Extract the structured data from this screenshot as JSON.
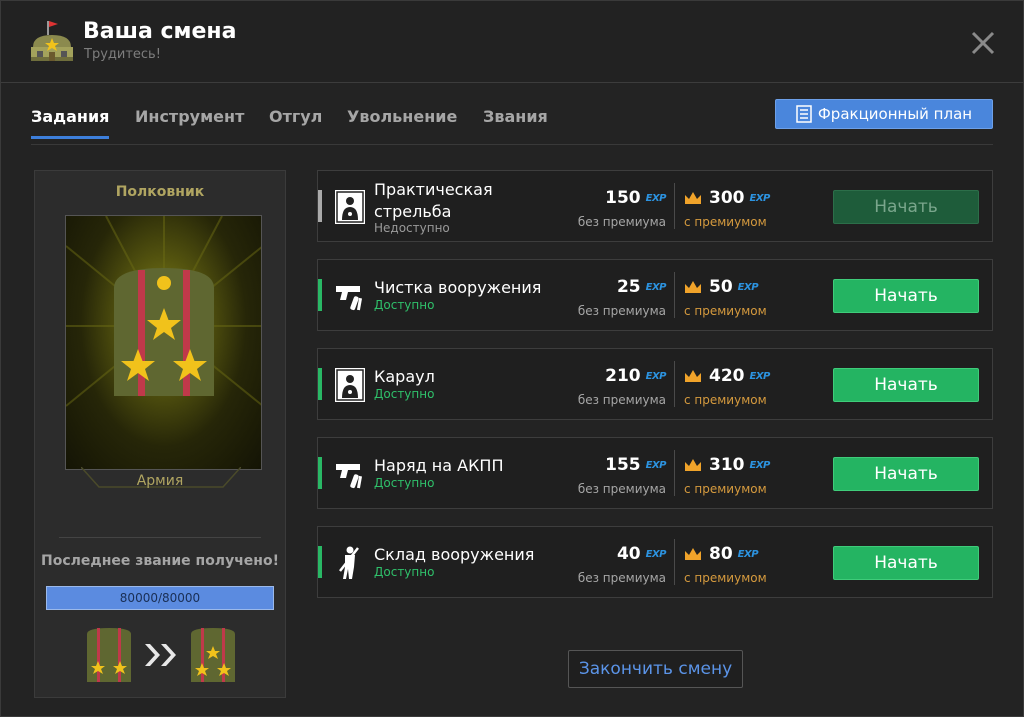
{
  "header": {
    "title": "Ваша смена",
    "subtitle": "Трудитесь!",
    "icon": "barracks-icon"
  },
  "tabs": [
    {
      "label": "Задания",
      "active": true
    },
    {
      "label": "Инструмент",
      "active": false
    },
    {
      "label": "Отгул",
      "active": false
    },
    {
      "label": "Увольнение",
      "active": false
    },
    {
      "label": "Звания",
      "active": false
    }
  ],
  "plan_button": {
    "label": "Фракционный план",
    "icon": "checklist-icon"
  },
  "rank_panel": {
    "rank_name": "Полковник",
    "branch": "Армия",
    "last_rank_message": "Последнее звание получено!",
    "progress": {
      "current": 80000,
      "max": 80000,
      "text": "80000/80000"
    },
    "transition_icon": "double-chevron-right-icon"
  },
  "exp_tag": "EXP",
  "tasks": [
    {
      "name": "Практическая стрельба",
      "name_lines": [
        "Практическая",
        "стрельба"
      ],
      "status": "Недоступно",
      "available": false,
      "icon": "shooting-target-icon",
      "exp_base": "150",
      "exp_premium": "300",
      "base_label": "без премиума",
      "premium_label": "с премиумом",
      "button": "Начать"
    },
    {
      "name": "Чистка вооружения",
      "name_lines": [
        "Чистка вооружения"
      ],
      "status": "Доступно",
      "available": true,
      "icon": "pistol-cleaning-icon",
      "exp_base": "25",
      "exp_premium": "50",
      "base_label": "без премиума",
      "premium_label": "с премиумом",
      "button": "Начать"
    },
    {
      "name": "Караул",
      "name_lines": [
        "Караул"
      ],
      "status": "Доступно",
      "available": true,
      "icon": "shooting-target-icon",
      "exp_base": "210",
      "exp_premium": "420",
      "base_label": "без премиума",
      "premium_label": "с премиумом",
      "button": "Начать"
    },
    {
      "name": "Наряд на АКПП",
      "name_lines": [
        "Наряд на АКПП"
      ],
      "status": "Доступно",
      "available": true,
      "icon": "pistol-cleaning-icon",
      "exp_base": "155",
      "exp_premium": "310",
      "base_label": "без премиума",
      "premium_label": "с премиумом",
      "button": "Начать"
    },
    {
      "name": "Склад вооружения",
      "name_lines": [
        "Склад вооружения"
      ],
      "status": "Доступно",
      "available": true,
      "icon": "soldier-rifle-icon",
      "exp_base": "40",
      "exp_premium": "80",
      "base_label": "без премиума",
      "premium_label": "с премиумом",
      "button": "Начать"
    }
  ],
  "finish_button": "Закончить смену",
  "colors": {
    "accent": "#3d7fdb",
    "success": "#24b462",
    "premium": "#d59a3e",
    "rank_gold": "#b0a561"
  }
}
